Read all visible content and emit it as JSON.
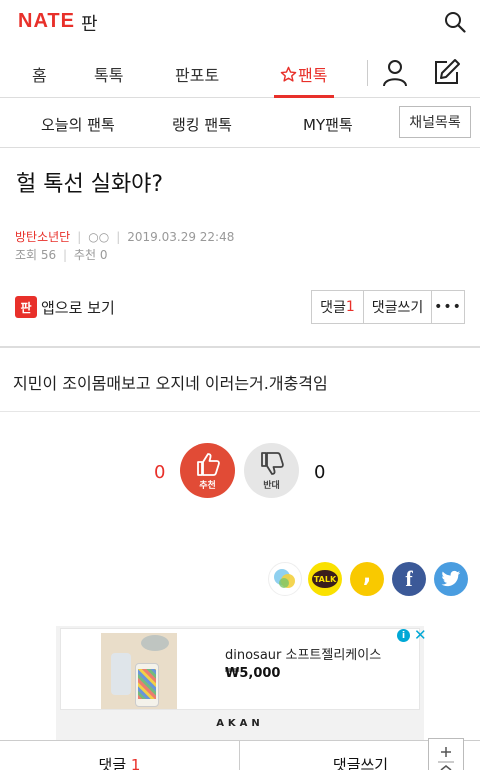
{
  "header": {
    "logo": "NATE",
    "logo_sub": "판"
  },
  "main_nav": {
    "tabs": [
      {
        "label": "홈"
      },
      {
        "label": "톡톡"
      },
      {
        "label": "판포토"
      },
      {
        "label": "팬톡",
        "active": true
      }
    ]
  },
  "sub_nav": {
    "items": [
      {
        "label": "오늘의 팬톡"
      },
      {
        "label": "랭킹 팬톡"
      },
      {
        "label": "MY팬톡"
      }
    ],
    "channel_button": "채널목록"
  },
  "post": {
    "title": "헐 톡선 실화야?",
    "author": "방탄소년단",
    "nickname": "○○",
    "date": "2019.03.29 22:48",
    "views_label": "조회",
    "views": "56",
    "recommend_label": "추천",
    "recommend": "0",
    "body": "지민이 조이몸매보고 오지네 이러는거.개충격임"
  },
  "actions": {
    "app_icon_text": "판",
    "app_label": "앱으로 보기",
    "comment_label": "댓글",
    "comment_count": "1",
    "write_comment_label": "댓글쓰기",
    "more_label": "•••"
  },
  "vote": {
    "recommend_count": "0",
    "recommend_label": "추천",
    "oppose_count": "0",
    "oppose_label": "반대"
  },
  "share": {
    "kakaotalk_label": "TALK",
    "kakaostory_label": ",",
    "facebook_label": "f"
  },
  "ad": {
    "title": "dinosaur 소프트젤리케이스",
    "price": "₩5,000",
    "info_label": "i",
    "close_label": "✕",
    "brand": "AKAN"
  },
  "bottom_bar": {
    "comment_label": "댓글",
    "comment_count": "1",
    "write_label": "댓글쓰기"
  },
  "colors": {
    "accent": "#e8302a",
    "recommend_button": "#e14b36",
    "oppose_button": "#e6e6e6",
    "facebook": "#3b5998",
    "twitter": "#4a9de0",
    "kakao": "#fae100"
  }
}
